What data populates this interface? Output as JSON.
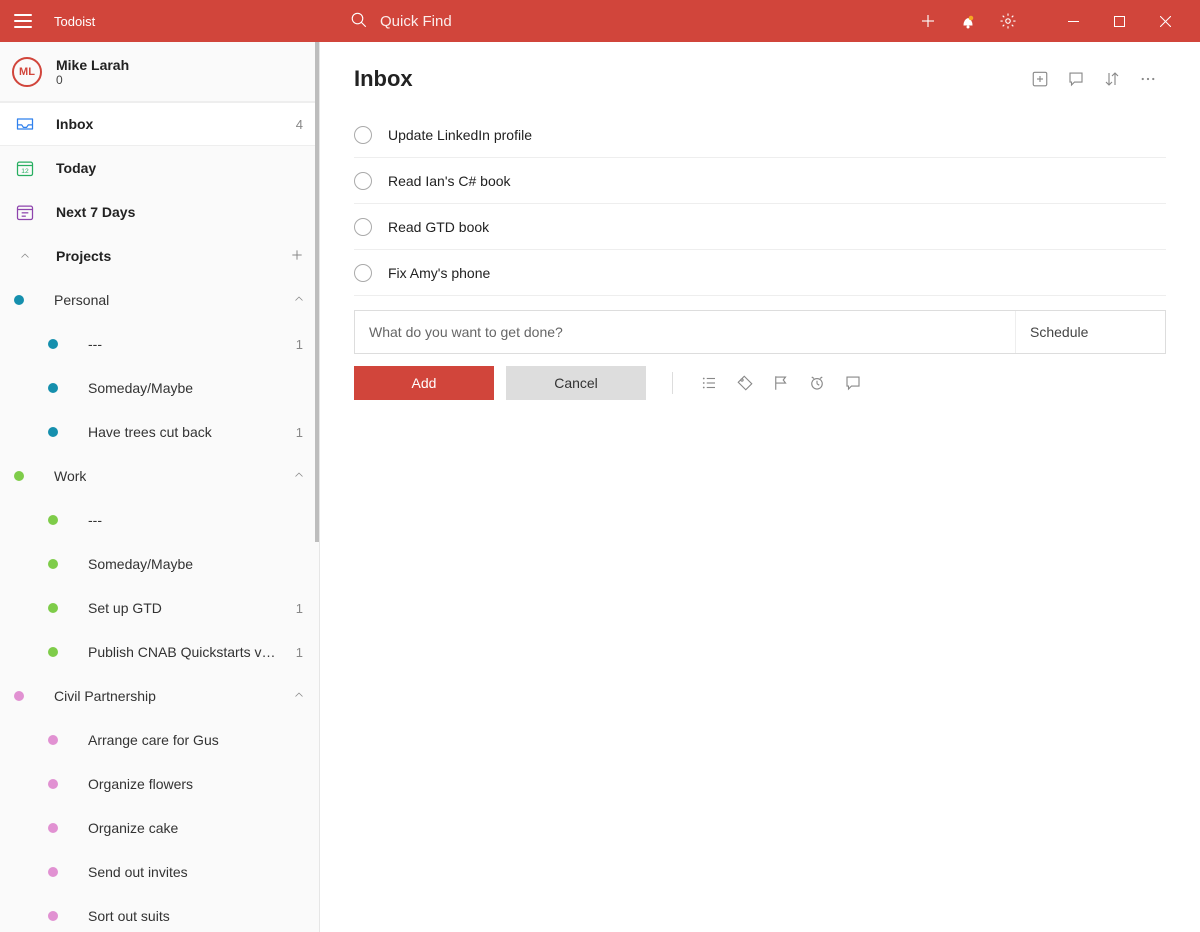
{
  "app": {
    "title": "Todoist",
    "search_placeholder": "Quick Find"
  },
  "user": {
    "initials": "ML",
    "name": "Mike Larah",
    "karma": "0"
  },
  "colors": {
    "brand": "#d1453b",
    "teal": "#158fad",
    "green": "#7ecc49",
    "pink": "#e191d2"
  },
  "nav": {
    "inbox": {
      "label": "Inbox",
      "count": "4"
    },
    "today": {
      "label": "Today",
      "date": "12"
    },
    "next7": {
      "label": "Next 7 Days"
    }
  },
  "sections": {
    "projects_label": "Projects"
  },
  "projects": [
    {
      "label": "Personal",
      "color": "#158fad",
      "indent": 0,
      "collapsible": true
    },
    {
      "label": "---",
      "color": "#158fad",
      "indent": 1,
      "count": "1"
    },
    {
      "label": "Someday/Maybe",
      "color": "#158fad",
      "indent": 1
    },
    {
      "label": "Have trees cut back",
      "color": "#158fad",
      "indent": 1,
      "count": "1"
    },
    {
      "label": "Work",
      "color": "#7ecc49",
      "indent": 0,
      "collapsible": true
    },
    {
      "label": "---",
      "color": "#7ecc49",
      "indent": 1
    },
    {
      "label": "Someday/Maybe",
      "color": "#7ecc49",
      "indent": 1
    },
    {
      "label": "Set up GTD",
      "color": "#7ecc49",
      "indent": 1,
      "count": "1"
    },
    {
      "label": "Publish CNAB Quickstarts video walkthrough",
      "color": "#7ecc49",
      "indent": 1,
      "count": "1"
    },
    {
      "label": "Civil Partnership",
      "color": "#e191d2",
      "indent": 0,
      "collapsible": true
    },
    {
      "label": "Arrange care for Gus",
      "color": "#e191d2",
      "indent": 1
    },
    {
      "label": "Organize flowers",
      "color": "#e191d2",
      "indent": 1
    },
    {
      "label": "Organize cake",
      "color": "#e191d2",
      "indent": 1
    },
    {
      "label": "Send out invites",
      "color": "#e191d2",
      "indent": 1
    },
    {
      "label": "Sort out suits",
      "color": "#e191d2",
      "indent": 1
    }
  ],
  "main": {
    "title": "Inbox",
    "tasks": [
      {
        "title": "Update LinkedIn profile"
      },
      {
        "title": "Read Ian's C# book"
      },
      {
        "title": "Read GTD book"
      },
      {
        "title": "Fix Amy's phone"
      }
    ],
    "add": {
      "placeholder": "What do you want to get done?",
      "schedule_label": "Schedule",
      "add_label": "Add",
      "cancel_label": "Cancel"
    }
  }
}
